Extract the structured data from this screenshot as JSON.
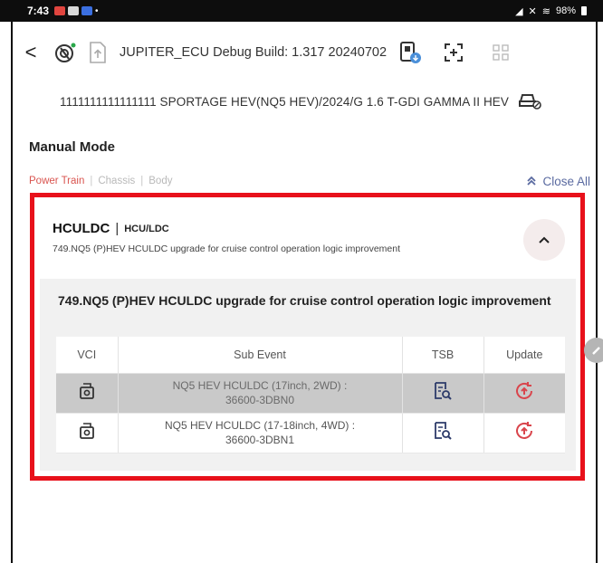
{
  "statusbar": {
    "time": "7:43",
    "right_text": "98%"
  },
  "appbar": {
    "back_glyph": "<",
    "build_title": "JUPITER_ECU Debug Build: 1.317 20240702",
    "icons": [
      "connection-icon",
      "upload-doc-icon",
      "download-device-icon",
      "screen-expand-icon",
      "grid-icon"
    ]
  },
  "vehicle": {
    "text": "1111111111111111  SPORTAGE HEV(NQ5 HEV)/2024/G 1.6 T-GDI GAMMA II HEV"
  },
  "manual_mode": {
    "title": "Manual Mode",
    "filters": [
      {
        "label": "Power Train",
        "active": true
      },
      {
        "label": "Chassis",
        "active": false
      },
      {
        "label": "Body",
        "active": false
      }
    ],
    "separator": "|",
    "close_all_label": "Close All"
  },
  "card": {
    "title": "HCULDC",
    "divider": "|",
    "subtitle": "HCU/LDC",
    "description": "749.NQ5 (P)HEV HCULDC upgrade for cruise control operation logic improvement",
    "body_title": "749.NQ5 (P)HEV HCULDC upgrade for cruise control operation logic improvement",
    "table": {
      "headers": [
        "VCI",
        "Sub Event",
        "TSB",
        "Update"
      ],
      "rows": [
        {
          "sub_event_line1": "NQ5 HEV HCULDC (17inch, 2WD) :",
          "sub_event_line2": "36600-3DBN0",
          "selected": true
        },
        {
          "sub_event_line1": "NQ5 HEV HCULDC (17-18inch, 4WD) :",
          "sub_event_line2": "36600-3DBN1",
          "selected": false
        }
      ]
    }
  },
  "colors": {
    "highlight": "#e8111b",
    "active_filter": "#d9544f",
    "close_all": "#5a6aa0",
    "update_icon": "#d9454c",
    "tsb_icon": "#2d3b6a"
  }
}
